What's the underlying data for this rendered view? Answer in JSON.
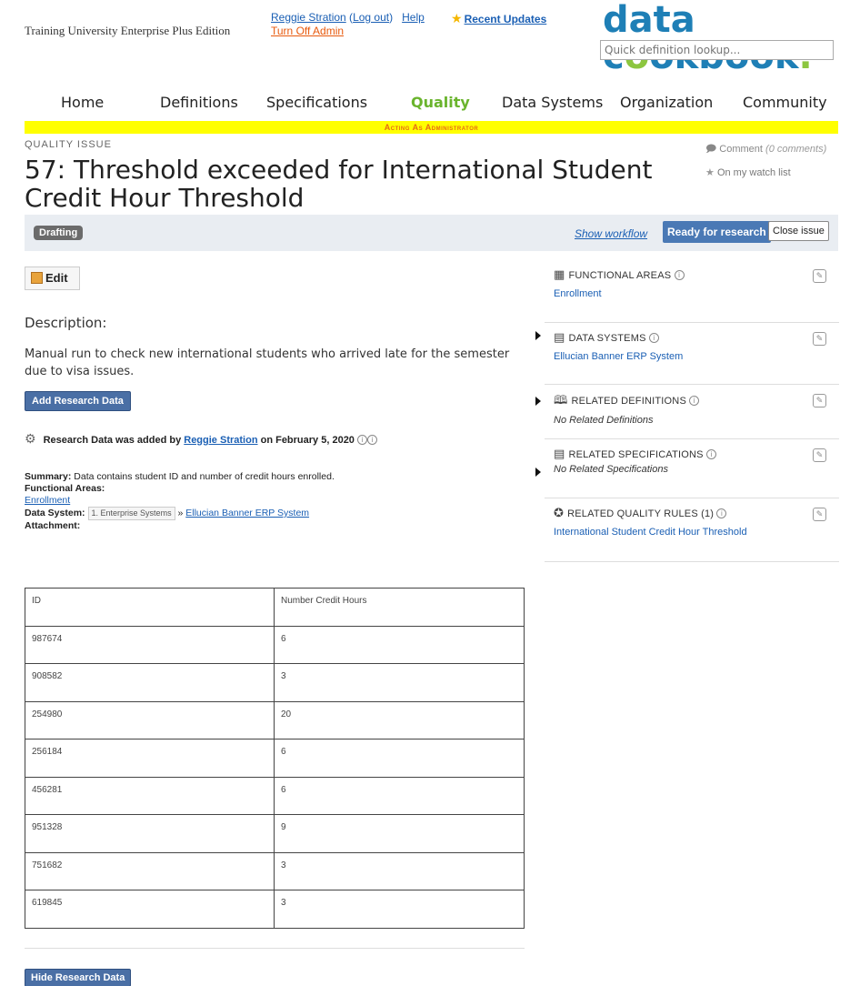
{
  "header": {
    "institution": "Training University Enterprise Plus Edition",
    "user_name": "Reggie Stration",
    "logout": "Log out",
    "help": "Help",
    "turn_off_admin": "Turn Off Admin",
    "recent_updates": "Recent Updates",
    "logo_a": "data c",
    "logo_b": "o",
    "logo_c": "okbook",
    "logo_dot": ".",
    "lookup_placeholder": "Quick definition lookup..."
  },
  "nav": [
    "Home",
    "Definitions",
    "Specifications",
    "Quality",
    "Data Systems",
    "Organization",
    "Community"
  ],
  "admin_banner": "Acting As Administrator",
  "issue": {
    "kicker": "QUALITY ISSUE",
    "title": "57: Threshold exceeded for International Student Credit Hour Threshold",
    "comment": "Comment",
    "comment_count": "(0 comments)",
    "watch": "On my watch list"
  },
  "workflow": {
    "status": "Drafting",
    "show_workflow": "Show workflow",
    "ready": "Ready for research",
    "close": "Close issue"
  },
  "content": {
    "edit": "Edit",
    "desc_heading": "Description:",
    "description": "Manual run to check new international students who arrived late for the semester due to visa issues.",
    "add_research": "Add Research Data",
    "rd_prefix": "Research Data was added by ",
    "rd_user": "Reggie Stration",
    "rd_date": " on February 5, 2020",
    "summary_label": "Summary:",
    "summary_text": " Data contains student ID and number of credit hours enrolled.",
    "functional_label": "Functional Areas:",
    "functional_value": "Enrollment",
    "datasystem_label": "Data System:",
    "datasystem_chip": "1. Enterprise Systems",
    "datasystem_sep": " » ",
    "datasystem_value": "Ellucian Banner ERP System",
    "attachment_label": "Attachment:",
    "hide_research": "Hide Research Data"
  },
  "table": {
    "headers": [
      "ID",
      "Number Credit Hours"
    ],
    "rows": [
      [
        "987674",
        "6"
      ],
      [
        "908582",
        "3"
      ],
      [
        "254980",
        "20"
      ],
      [
        "256184",
        "6"
      ],
      [
        "456281",
        "6"
      ],
      [
        "951328",
        "9"
      ],
      [
        "751682",
        "3"
      ],
      [
        "619845",
        "3"
      ]
    ]
  },
  "sidebar": {
    "functional_areas": {
      "title": "FUNCTIONAL AREAS",
      "value": "Enrollment"
    },
    "data_systems": {
      "title": "DATA SYSTEMS",
      "value": "Ellucian Banner ERP System"
    },
    "related_definitions": {
      "title": "RELATED DEFINITIONS",
      "value": "No Related Definitions"
    },
    "related_specifications": {
      "title": "RELATED SPECIFICATIONS",
      "value": "No Related Specifications"
    },
    "related_quality_rules": {
      "title": "RELATED QUALITY RULES (1)",
      "value": "International Student Credit Hour Threshold"
    }
  }
}
